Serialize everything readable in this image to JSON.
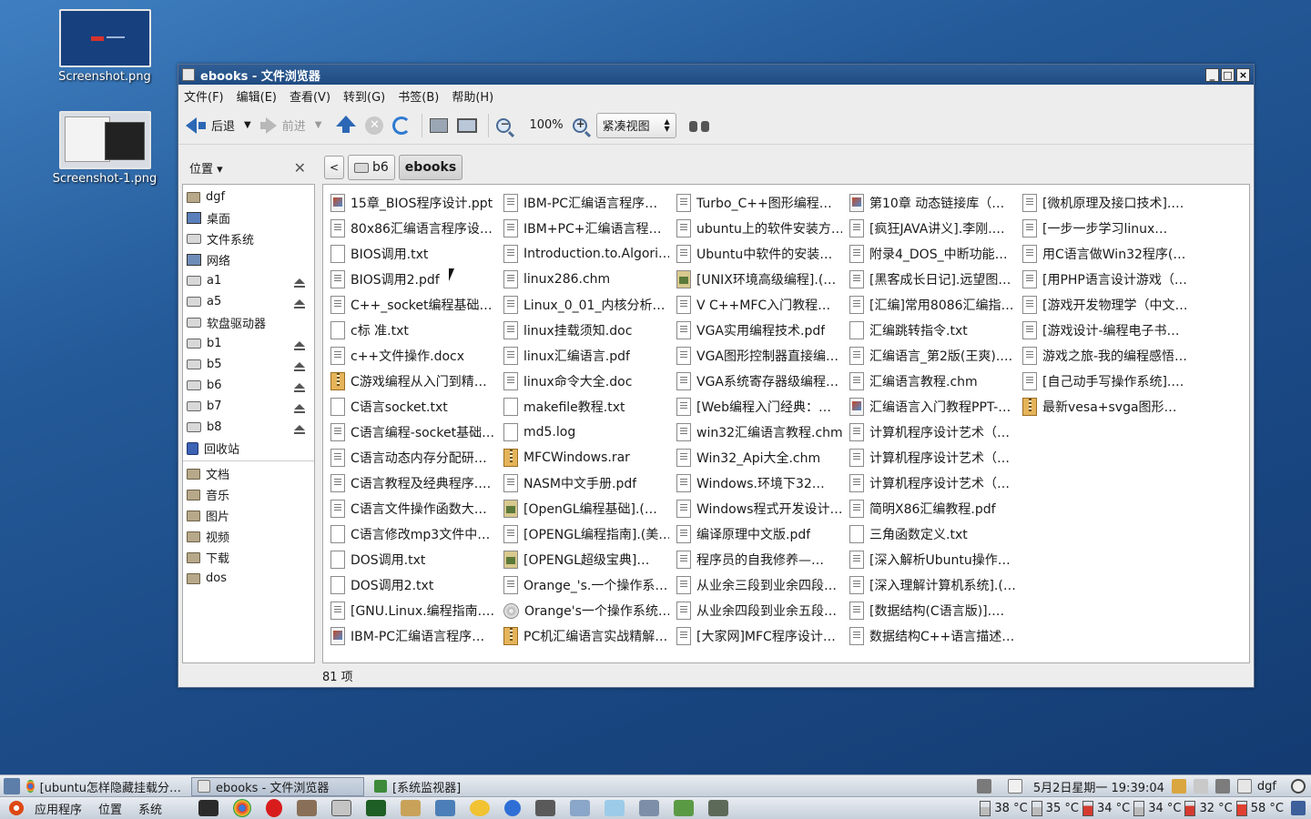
{
  "desktop": {
    "icons": [
      {
        "label": "Screenshot.png"
      },
      {
        "label": "Screenshot-1.png"
      }
    ]
  },
  "window": {
    "title": "ebooks - 文件浏览器"
  },
  "menubar": [
    "文件(F)",
    "编辑(E)",
    "查看(V)",
    "转到(G)",
    "书签(B)",
    "帮助(H)"
  ],
  "toolbar": {
    "back": "后退",
    "forward": "前进",
    "zoom": "100%",
    "view_mode": "紧凑视图"
  },
  "sidebar": {
    "title": "位置",
    "items": [
      {
        "label": "dgf",
        "icon": "folder-icon",
        "eject": false
      },
      {
        "label": "桌面",
        "icon": "desktop-icon",
        "eject": false
      },
      {
        "label": "文件系统",
        "icon": "drive-icon",
        "eject": false
      },
      {
        "label": "网络",
        "icon": "network-icon",
        "eject": false
      },
      {
        "label": "a1",
        "icon": "drive-icon",
        "eject": true
      },
      {
        "label": "a5",
        "icon": "drive-icon",
        "eject": true
      },
      {
        "label": "软盘驱动器",
        "icon": "drive-icon",
        "eject": false
      },
      {
        "label": "b1",
        "icon": "drive-icon",
        "eject": true
      },
      {
        "label": "b5",
        "icon": "drive-icon",
        "eject": true
      },
      {
        "label": "b6",
        "icon": "drive-icon",
        "eject": true
      },
      {
        "label": "b7",
        "icon": "drive-icon",
        "eject": true
      },
      {
        "label": "b8",
        "icon": "drive-icon",
        "eject": true
      },
      {
        "label": "回收站",
        "icon": "trash-icon",
        "eject": false
      }
    ],
    "bookmarks": [
      "文档",
      "音乐",
      "图片",
      "视频",
      "下载",
      "dos"
    ]
  },
  "pathbar": {
    "crumbs": [
      "b6",
      "ebooks"
    ]
  },
  "files": [
    [
      {
        "name": "15章_BIOS程序设计.ppt",
        "type": "ppt"
      },
      {
        "name": "80x86汇编语言程序设…",
        "type": "doc"
      },
      {
        "name": "BIOS调用.txt",
        "type": "txt"
      },
      {
        "name": "BIOS调用2.pdf",
        "type": "doc"
      },
      {
        "name": "C++_socket编程基础…",
        "type": "doc"
      },
      {
        "name": "c标 准.txt",
        "type": "txt"
      },
      {
        "name": "c++文件操作.docx",
        "type": "doc"
      },
      {
        "name": "C游戏编程从入门到精…",
        "type": "arc"
      },
      {
        "name": "C语言socket.txt",
        "type": "txt"
      },
      {
        "name": "C语言编程-socket基础…",
        "type": "doc"
      },
      {
        "name": "C语言动态内存分配研…",
        "type": "doc"
      },
      {
        "name": "C语言教程及经典程序.…",
        "type": "doc"
      },
      {
        "name": "C语言文件操作函数大…",
        "type": "doc"
      },
      {
        "name": "C语言修改mp3文件中…",
        "type": "txt"
      },
      {
        "name": "DOS调用.txt",
        "type": "txt"
      },
      {
        "name": "DOS调用2.txt",
        "type": "txt"
      },
      {
        "name": "[GNU.Linux.编程指南.…",
        "type": "doc"
      },
      {
        "name": "IBM-PC汇编语言程序…",
        "type": "ppt"
      }
    ],
    [
      {
        "name": "IBM-PC汇编语言程序…",
        "type": "doc"
      },
      {
        "name": "IBM+PC+汇编语言程…",
        "type": "doc"
      },
      {
        "name": "Introduction.to.Algori…",
        "type": "doc"
      },
      {
        "name": "linux286.chm",
        "type": "doc"
      },
      {
        "name": "Linux_0_01_内核分析…",
        "type": "doc"
      },
      {
        "name": "linux挂载须知.doc",
        "type": "doc"
      },
      {
        "name": "linux汇编语言.pdf",
        "type": "doc"
      },
      {
        "name": "linux命令大全.doc",
        "type": "doc"
      },
      {
        "name": "makefile教程.txt",
        "type": "txt"
      },
      {
        "name": "md5.log",
        "type": "txt"
      },
      {
        "name": "MFCWindows.rar",
        "type": "arc"
      },
      {
        "name": "NASM中文手册.pdf",
        "type": "doc"
      },
      {
        "name": "[OpenGL编程基础].(…",
        "type": "img"
      },
      {
        "name": "[OPENGL编程指南].(美…",
        "type": "doc"
      },
      {
        "name": "[OPENGL超级宝典]…",
        "type": "img"
      },
      {
        "name": "Orange_'s.一个操作系…",
        "type": "doc"
      },
      {
        "name": "Orange's一个操作系统…",
        "type": "iso"
      },
      {
        "name": "PC机汇编语言实战精解…",
        "type": "arc"
      }
    ],
    [
      {
        "name": "Turbo_C++图形编程…",
        "type": "doc"
      },
      {
        "name": "ubuntu上的软件安装方…",
        "type": "doc"
      },
      {
        "name": "Ubuntu中软件的安装…",
        "type": "doc"
      },
      {
        "name": "[UNIX环境高级编程].(…",
        "type": "img"
      },
      {
        "name": "V C++MFC入门教程…",
        "type": "doc"
      },
      {
        "name": "VGA实用编程技术.pdf",
        "type": "doc"
      },
      {
        "name": "VGA图形控制器直接编…",
        "type": "doc"
      },
      {
        "name": "VGA系统寄存器级编程…",
        "type": "doc"
      },
      {
        "name": "[Web编程入门经典：…",
        "type": "doc"
      },
      {
        "name": "win32汇编语言教程.chm",
        "type": "doc"
      },
      {
        "name": "Win32_Api大全.chm",
        "type": "doc"
      },
      {
        "name": "Windows.环境下32…",
        "type": "doc"
      },
      {
        "name": "Windows程式开发设计…",
        "type": "doc"
      },
      {
        "name": "编译原理中文版.pdf",
        "type": "doc"
      },
      {
        "name": "程序员的自我修养—…",
        "type": "doc"
      },
      {
        "name": "从业余三段到业余四段…",
        "type": "doc"
      },
      {
        "name": "从业余四段到业余五段…",
        "type": "doc"
      },
      {
        "name": "[大家网]MFC程序设计…",
        "type": "doc"
      }
    ],
    [
      {
        "name": "第10章  动态链接库（…",
        "type": "ppt"
      },
      {
        "name": "[疯狂JAVA讲义].李刚.…",
        "type": "doc"
      },
      {
        "name": "附录4_DOS_中断功能…",
        "type": "doc"
      },
      {
        "name": "[黑客成长日记].远望图…",
        "type": "doc"
      },
      {
        "name": "[汇编]常用8086汇编指…",
        "type": "doc"
      },
      {
        "name": "汇编跳转指令.txt",
        "type": "txt"
      },
      {
        "name": "汇编语言_第2版(王爽).…",
        "type": "doc"
      },
      {
        "name": "汇编语言教程.chm",
        "type": "doc"
      },
      {
        "name": "汇编语言入门教程PPT-…",
        "type": "ppt"
      },
      {
        "name": "计算机程序设计艺术（…",
        "type": "doc"
      },
      {
        "name": "计算机程序设计艺术（…",
        "type": "doc"
      },
      {
        "name": "计算机程序设计艺术（…",
        "type": "doc"
      },
      {
        "name": "简明X86汇编教程.pdf",
        "type": "doc"
      },
      {
        "name": "三角函数定义.txt",
        "type": "txt"
      },
      {
        "name": "[深入解析Ubuntu操作…",
        "type": "doc"
      },
      {
        "name": "[深入理解计算机系统].(…",
        "type": "doc"
      },
      {
        "name": "[数据结构(C语言版)].…",
        "type": "doc"
      },
      {
        "name": "数据结构C++语言描述…",
        "type": "doc"
      }
    ],
    [
      {
        "name": "[微机原理及接口技术].…",
        "type": "doc"
      },
      {
        "name": "[一步一步学习linux…",
        "type": "doc"
      },
      {
        "name": "用C语言做Win32程序(…",
        "type": "doc"
      },
      {
        "name": "[用PHP语言设计游戏（…",
        "type": "doc"
      },
      {
        "name": "[游戏开发物理学（中文…",
        "type": "doc"
      },
      {
        "name": "[游戏设计-编程电子书…",
        "type": "doc"
      },
      {
        "name": "游戏之旅-我的编程感悟…",
        "type": "doc"
      },
      {
        "name": "[自己动手写操作系统].…",
        "type": "doc"
      },
      {
        "name": "最新vesa+svga图形…",
        "type": "arc"
      }
    ]
  ],
  "status": "81 项",
  "taskbar": {
    "tasks": [
      "[ubuntu怎样隐藏挂载分…",
      "ebooks - 文件浏览器",
      "[系统监视器]"
    ],
    "datetime": "5月2日星期一 19:39:04",
    "user": "dgf",
    "menus": [
      "应用程序",
      "位置",
      "系统"
    ],
    "temps": [
      "38 °C",
      "35 °C",
      "34 °C",
      "34 °C",
      "32 °C",
      "58 °C"
    ]
  }
}
